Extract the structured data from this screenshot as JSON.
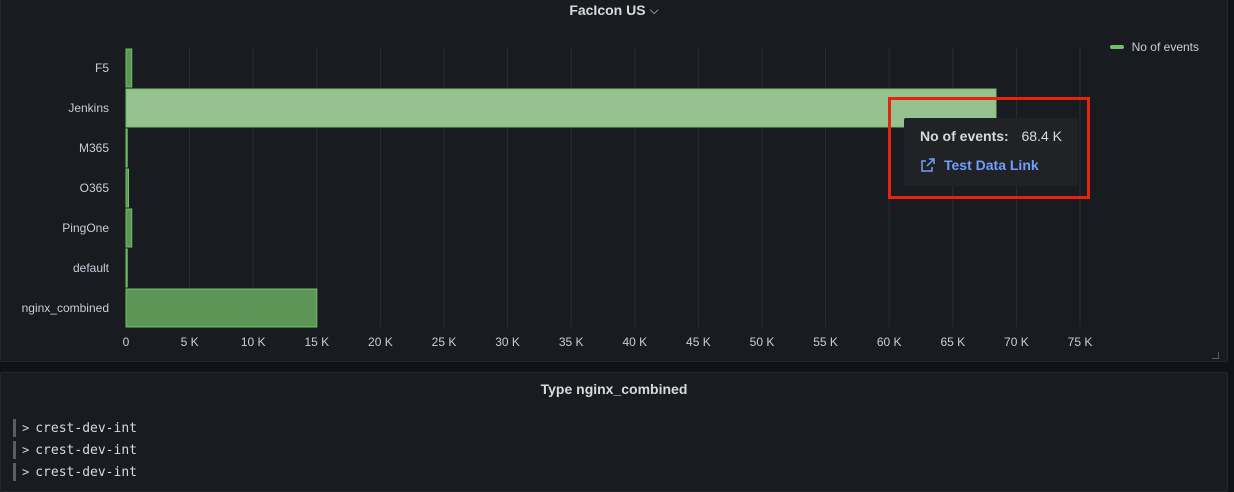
{
  "top_panel": {
    "title": "FacIcon US",
    "title_chevron": "⌵"
  },
  "chart_data": {
    "type": "bar",
    "orientation": "horizontal",
    "categories": [
      "F5",
      "Jenkins",
      "M365",
      "O365",
      "PingOne",
      "default",
      "nginx_combined"
    ],
    "series": [
      {
        "name": "No of events",
        "values": [
          450,
          68400,
          80,
          200,
          450,
          20,
          15000
        ],
        "color": "#73bf69"
      }
    ],
    "highlighted_category": "Jenkins",
    "xlim": [
      0,
      75000
    ],
    "x_ticks": [
      0,
      5000,
      10000,
      15000,
      20000,
      25000,
      30000,
      35000,
      40000,
      45000,
      50000,
      55000,
      60000,
      65000,
      70000,
      75000
    ],
    "x_tick_labels": [
      "0",
      "5 K",
      "10 K",
      "15 K",
      "20 K",
      "25 K",
      "30 K",
      "35 K",
      "40 K",
      "45 K",
      "50 K",
      "55 K",
      "60 K",
      "65 K",
      "70 K",
      "75 K"
    ],
    "grid": true,
    "legend_position": "top-right"
  },
  "legend": {
    "label": "No of events",
    "color": "#73bf69"
  },
  "tooltip": {
    "series_label": "No of events:",
    "value": "68.4 K",
    "link_label": "Test Data Link",
    "link_icon": "external-link-icon"
  },
  "bottom_panel": {
    "title": "Type nginx_combined",
    "rows": [
      {
        "text": "crest-dev-int"
      },
      {
        "text": "crest-dev-int"
      },
      {
        "text": "crest-dev-int"
      }
    ]
  },
  "colors": {
    "bar": "#73bf69",
    "bar_highlight": "#96c290",
    "grid": "#2a2d33",
    "highlight_box": "#e8230c",
    "link": "#6e9fff"
  }
}
